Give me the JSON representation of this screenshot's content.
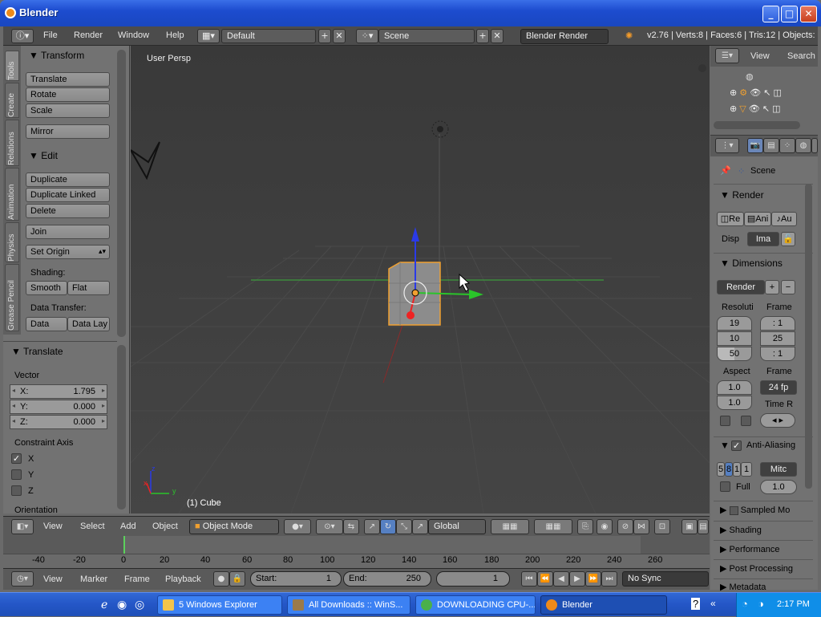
{
  "window": {
    "title": "Blender",
    "min_label": "_",
    "max_label": "□",
    "close_label": "✕"
  },
  "menubar": {
    "menus": [
      "File",
      "Render",
      "Window",
      "Help"
    ],
    "screen_layout": "Default",
    "scene": "Scene",
    "engine": "Blender Render",
    "stats": "v2.76 | Verts:8 | Faces:6 | Tris:12 | Objects:"
  },
  "tool_tabs": [
    "Tools",
    "Create",
    "Relations",
    "Animation",
    "Physics",
    "Grease Pencil"
  ],
  "toolshelf": {
    "transform": {
      "header": "Transform",
      "buttons": [
        "Translate",
        "Rotate",
        "Scale",
        "Mirror"
      ]
    },
    "edit": {
      "header": "Edit",
      "buttons": [
        "Duplicate",
        "Duplicate Linked",
        "Delete",
        "Join",
        "Set Origin"
      ]
    },
    "shading_label": "Shading:",
    "shading_buttons": [
      "Smooth",
      "Flat"
    ],
    "data_transfer_label": "Data Transfer:",
    "data_transfer_buttons": [
      "Data",
      "Data Lay"
    ]
  },
  "operator_panel": {
    "header": "Translate",
    "vector_label": "Vector",
    "fields": [
      {
        "key": "X:",
        "value": "1.795"
      },
      {
        "key": "Y:",
        "value": "0.000"
      },
      {
        "key": "Z:",
        "value": "0.000"
      }
    ],
    "constraint_label": "Constraint Axis",
    "constraints": [
      {
        "axis": "X",
        "checked": true
      },
      {
        "axis": "Y",
        "checked": false
      },
      {
        "axis": "Z",
        "checked": false
      }
    ],
    "orientation_label": "Orientation"
  },
  "viewport": {
    "view_name": "User Persp",
    "object_label": "(1) Cube",
    "axis_x": "x",
    "axis_y": "y",
    "axis_z": "z",
    "colors": {
      "x_axis": "#d22",
      "y_axis": "#2c2",
      "z_axis": "#22e",
      "selection": "#f0a030"
    }
  },
  "viewport_header": {
    "menus": [
      "View",
      "Select",
      "Add",
      "Object"
    ],
    "mode": "Object Mode",
    "orientation": "Global"
  },
  "timeline": {
    "ticks": [
      "-40",
      "-20",
      "0",
      "20",
      "40",
      "60",
      "80",
      "100",
      "120",
      "140",
      "160",
      "180",
      "200",
      "220",
      "240",
      "260"
    ],
    "current_frame_marker": 0
  },
  "timeline_header": {
    "menus": [
      "View",
      "Marker",
      "Frame",
      "Playback"
    ],
    "start_label": "Start:",
    "start_value": "1",
    "end_label": "End:",
    "end_value": "250",
    "current_frame": "1",
    "sync": "No Sync"
  },
  "outliner": {
    "menu_view": "View",
    "menu_search": "Search"
  },
  "properties": {
    "scene_label": "Scene",
    "render_header": "Render",
    "render_buttons": [
      "Re",
      "Ani",
      "Au"
    ],
    "disp_label": "Disp",
    "disp_value": "Ima",
    "dimensions_header": "Dimensions",
    "preset": "Render",
    "resolution_label": "Resoluti",
    "frame_label": "Frame",
    "res_values": [
      "19",
      "10",
      "50"
    ],
    "frame_values": [
      ": 1",
      "25",
      ": 1"
    ],
    "aspect_label": "Aspect",
    "frame_rate_label": "Frame",
    "aspect_values": [
      "1.0",
      "1.0"
    ],
    "fps_value": "24 fp",
    "time_label": "Time R",
    "anti_aliasing": "Anti-Aliasing",
    "aa_samples": [
      "5",
      "8",
      "1",
      "1"
    ],
    "aa_filter": "Mitc",
    "full_label": "Full",
    "full_value": "1.0",
    "collapsed": [
      "Sampled Mo",
      "Shading",
      "Performance",
      "Post Processing",
      "Metadata"
    ]
  },
  "taskbar": {
    "tasks": [
      {
        "label": "5 Windows Explorer",
        "active": false
      },
      {
        "label": "All Downloads :: WinS...",
        "active": false
      },
      {
        "label": "DOWNLOADING CPU-...",
        "active": false
      },
      {
        "label": "Blender",
        "active": true
      }
    ],
    "clock": "2:17 PM"
  }
}
